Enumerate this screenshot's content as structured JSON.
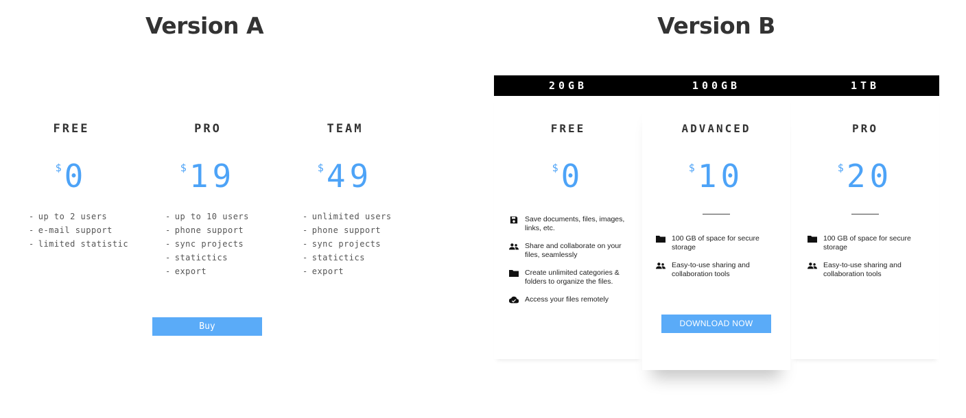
{
  "version_a": {
    "title": "Version A",
    "plans": [
      {
        "name": "FREE",
        "currency": "$",
        "price": "0",
        "features": [
          "up to 2 users",
          "e-mail support",
          "limited statistic"
        ]
      },
      {
        "name": "PRO",
        "currency": "$",
        "price": "19",
        "features": [
          "up to 10 users",
          "phone support",
          "sync projects",
          "statictics",
          "export"
        ]
      },
      {
        "name": "TEAM",
        "currency": "$",
        "price": "49",
        "features": [
          "unlimited users",
          "phone support",
          "sync projects",
          "statictics",
          "export"
        ]
      }
    ],
    "dash": "-",
    "buy_label": "Buy"
  },
  "version_b": {
    "title": "Version B",
    "capacities": [
      "20GB",
      "100GB",
      "1TB"
    ],
    "plans": [
      {
        "name": "FREE",
        "currency": "$",
        "price": "0",
        "features": [
          {
            "icon": "save-icon",
            "text": "Save documents, files, images, links, etc."
          },
          {
            "icon": "people-icon",
            "text": "Share and collaborate on your files, seamlessly"
          },
          {
            "icon": "folder-icon",
            "text": "Create unlimited categories & folders to organize the files."
          },
          {
            "icon": "cloud-check-icon",
            "text": "Access your files remotely"
          }
        ]
      },
      {
        "name": "ADVANCED",
        "currency": "$",
        "price": "10",
        "features": [
          {
            "icon": "folder-icon",
            "text": "100 GB of space for secure storage"
          },
          {
            "icon": "people-icon",
            "text": "Easy-to-use sharing and collaboration tools"
          }
        ]
      },
      {
        "name": "PRO",
        "currency": "$",
        "price": "20",
        "features": [
          {
            "icon": "folder-icon",
            "text": "100 GB of space for secure storage"
          },
          {
            "icon": "people-icon",
            "text": "Easy-to-use sharing and collaboration tools"
          }
        ]
      }
    ],
    "download_label": "DOWNLOAD NOW"
  },
  "colors": {
    "accent": "#5aabf8",
    "price": "#4da3f7",
    "bar": "#000000"
  }
}
